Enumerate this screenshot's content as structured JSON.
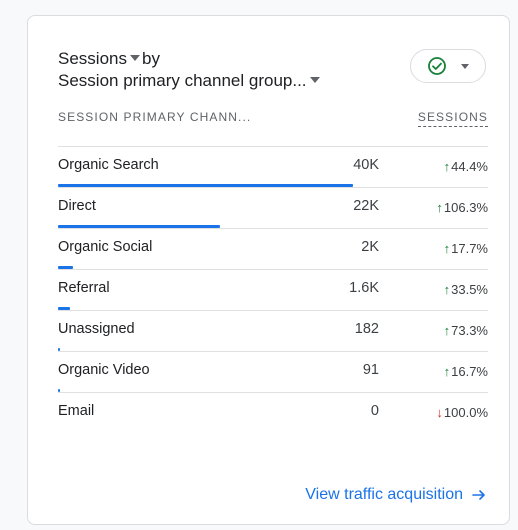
{
  "title": {
    "metric": "Sessions",
    "connector": "by",
    "dimension": "Session primary channel group..."
  },
  "status_icon": "check-circle-icon",
  "colors": {
    "accent": "#1a73e8",
    "positive": "#188038",
    "negative": "#d93025",
    "status": "#188038"
  },
  "table": {
    "headers": {
      "dimension": "SESSION PRIMARY CHANN...",
      "metric": "SESSIONS"
    },
    "rows": [
      {
        "name": "Organic Search",
        "value": "40K",
        "change": "44.4%",
        "direction": "up",
        "share": 1.0
      },
      {
        "name": "Direct",
        "value": "22K",
        "change": "106.3%",
        "direction": "up",
        "share": 0.55
      },
      {
        "name": "Organic Social",
        "value": "2K",
        "change": "17.7%",
        "direction": "up",
        "share": 0.05
      },
      {
        "name": "Referral",
        "value": "1.6K",
        "change": "33.5%",
        "direction": "up",
        "share": 0.04
      },
      {
        "name": "Unassigned",
        "value": "182",
        "change": "73.3%",
        "direction": "up",
        "share": 0.0046
      },
      {
        "name": "Organic Video",
        "value": "91",
        "change": "16.7%",
        "direction": "up",
        "share": 0.0023
      },
      {
        "name": "Email",
        "value": "0",
        "change": "100.0%",
        "direction": "down",
        "share": 0
      }
    ]
  },
  "footer": {
    "link_label": "View traffic acquisition",
    "icon": "arrow-right-icon"
  }
}
